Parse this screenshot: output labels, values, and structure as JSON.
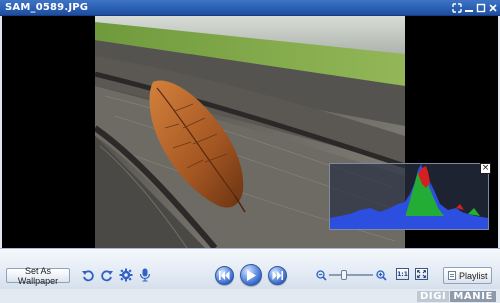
{
  "window": {
    "title": "SAM_0589.JPG"
  },
  "titlebar_icons": [
    "fullscreen-icon",
    "minimize-icon",
    "maximize-icon",
    "close-icon"
  ],
  "toolbar": {
    "wallpaper_label": "Set As Wallpaper",
    "playlist_label": "Playlist",
    "actual_size_label": "1:1",
    "icons": [
      "rotate-left-icon",
      "rotate-right-icon",
      "settings-icon",
      "microphone-icon",
      "previous-icon",
      "play-icon",
      "next-icon",
      "zoom-out-icon",
      "zoom-in-icon",
      "fit-to-window-icon"
    ]
  },
  "zoom": {
    "level": 0.35
  },
  "histogram": {
    "close_label": "×",
    "colors": {
      "red": "#d81f1f",
      "green": "#24b22c",
      "blue": "#2c4fe0"
    }
  },
  "watermark": {
    "part1": "DIGI",
    "part2": "MANIE"
  },
  "colors": {
    "titlebar": "#2a5fb4",
    "toolbar": "#e6edf6",
    "accent": "#2e63c9"
  }
}
